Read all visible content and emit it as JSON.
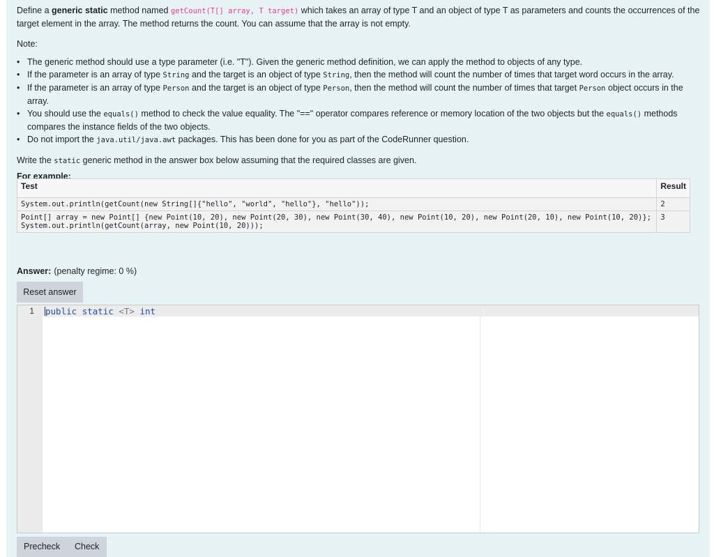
{
  "question": {
    "intro_1": "Define a ",
    "intro_bold": "generic static",
    "intro_2": " method named ",
    "intro_code": "getCount(T[] array, T target)",
    "intro_3": " which takes an array of type T and an object of type T as parameters and counts the occurrences of the target element in the array. The method returns the count. You can assume that the array is not empty.",
    "note_label": "Note:",
    "bullets": {
      "b1": "The generic method should use a type parameter (i.e. \"T\"). Given the generic method definition, we can apply the method to objects of any type.",
      "b2_a": "If the parameter is an array of type ",
      "b2_code1": "String",
      "b2_b": " and the target is an object of type ",
      "b2_code2": "String",
      "b2_c": ", then the method will count the number of times that target word occurs in the array.",
      "b3_a": "If the parameter is an array of type ",
      "b3_code1": "Person",
      "b3_b": " and the target is an object of type ",
      "b3_code2": "Person",
      "b3_c": ", then the method will count the number of times that target ",
      "b3_code3": "Person",
      "b3_d": " object occurs in the array.",
      "b4_a": "You should use the ",
      "b4_code1": "equals()",
      "b4_b": " method to check the value equality. The \"==\" operator compares reference or memory location of the two objects but the ",
      "b4_code2": "equals()",
      "b4_c": " methods compares the instance fields of the two objects.",
      "b5_a": "Do not import the ",
      "b5_code": "java.util/java.awt",
      "b5_b": " packages. This has been done for you as part of the CodeRunner question."
    },
    "write_a": "Write the ",
    "write_code": "static",
    "write_b": " generic method in the answer box below assuming that the required classes are given.",
    "for_example": "For example:"
  },
  "examples": {
    "header_test": "Test",
    "header_result": "Result",
    "row1_test": "System.out.println(getCount(new String[]{\"hello\", \"world\", \"hello\"}, \"hello\"));",
    "row1_result": "2",
    "row2_test_line1": "Point[] array = new Point[] {new Point(10, 20), new Point(20, 30), new Point(30, 40), new Point(10, 20), new Point(20, 10), new Point(10, 20)};",
    "row2_test_line2": "System.out.println(getCount(array, new Point(10, 20)));",
    "row2_result": "3"
  },
  "answer": {
    "label": "Answer:",
    "penalty": "(penalty regime: 0 %)",
    "reset_label": "Reset answer",
    "line_number": "1",
    "code_kw1": "public",
    "code_kw2": "static",
    "code_generic": "<T>",
    "code_kw3": "int"
  },
  "actions": {
    "precheck_label": "Precheck",
    "check_label": "Check"
  }
}
